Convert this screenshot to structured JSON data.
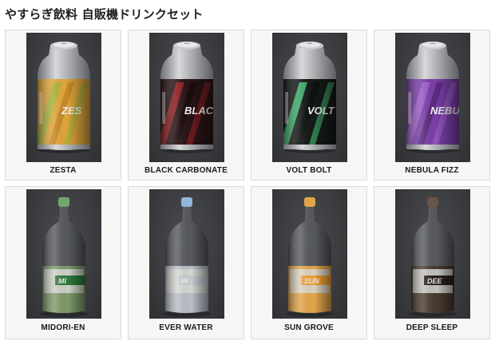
{
  "header": {
    "title": "やすらぎ飲料 自販機ドリンクセット"
  },
  "products": [
    {
      "name": "ZESTA",
      "kind": "can",
      "label_text": "ZES",
      "colors": {
        "base": "#e0a53b",
        "stripe": "#a8b23a",
        "dark": "#c98a2a"
      }
    },
    {
      "name": "BLACK CARBONATE",
      "kind": "can",
      "label_text": "BLACK C",
      "colors": {
        "base": "#2a1416",
        "stripe": "#8a1e22",
        "dark": "#1a0c0d"
      }
    },
    {
      "name": "VOLT BOLT",
      "kind": "can",
      "label_text": "VOLT",
      "colors": {
        "base": "#151a18",
        "stripe": "#3fa868",
        "dark": "#0e1210"
      }
    },
    {
      "name": "NEBULA FIZZ",
      "kind": "can",
      "label_text": "NEBU",
      "colors": {
        "base": "#7a3fa8",
        "stripe": "#9b5cc8",
        "dark": "#5c2c80"
      }
    },
    {
      "name": "MIDORI-EN",
      "kind": "bottle",
      "label_text": "MI",
      "colors": {
        "liquid": "#7f9a6a",
        "cap": "#6fa86a",
        "band": "#2e7a3e"
      }
    },
    {
      "name": "EVER WATER",
      "kind": "bottle",
      "label_text": "W",
      "colors": {
        "liquid": "#b9bfc6",
        "cap": "#8fb6dc",
        "band": "#c8ccd0"
      }
    },
    {
      "name": "SUN GROVE",
      "kind": "bottle",
      "label_text": "SUN",
      "colors": {
        "liquid": "#e3a54a",
        "cap": "#e0a44a",
        "band": "#f0a032"
      }
    },
    {
      "name": "DEEP SLEEP",
      "kind": "bottle",
      "label_text": "DEE",
      "colors": {
        "liquid": "#4a3a30",
        "cap": "#6a5448",
        "band": "#2a1e18"
      }
    }
  ]
}
